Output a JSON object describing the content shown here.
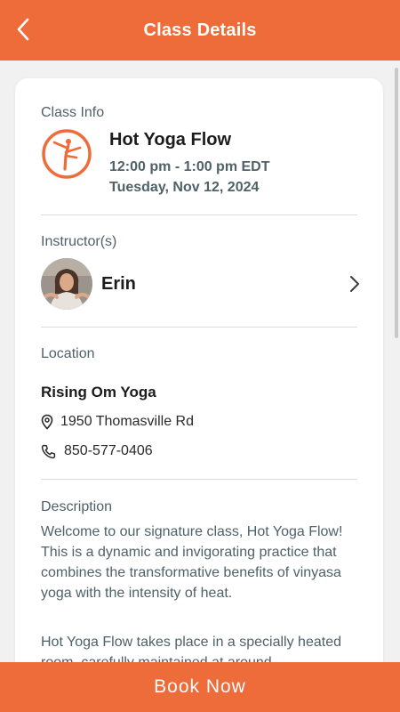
{
  "header": {
    "title": "Class Details",
    "back_icon": "chevron-left-icon",
    "color": "#ee6b3a"
  },
  "class_info": {
    "section_label": "Class Info",
    "icon": "yoga-pose-icon",
    "name": "Hot Yoga Flow",
    "time": "12:00 pm - 1:00 pm EDT",
    "date": "Tuesday, Nov 12, 2024"
  },
  "instructor": {
    "section_label": "Instructor(s)",
    "name": "Erin",
    "chevron_icon": "chevron-right-icon"
  },
  "location": {
    "section_label": "Location",
    "name": "Rising Om Yoga",
    "address": "1950 Thomasville Rd",
    "address_icon": "map-pin-icon",
    "phone": "850-577-0406",
    "phone_icon": "phone-icon"
  },
  "description": {
    "section_label": "Description",
    "paragraph_1": "Welcome to our signature class, Hot Yoga Flow! This is a dynamic and invigorating practice that combines the transformative benefits of vinyasa yoga with the intensity of heat.",
    "paragraph_2": "Hot Yoga Flow takes place in a specially heated room, carefully maintained at around"
  },
  "footer": {
    "book_label": "Book Now"
  },
  "colors": {
    "accent": "#ee6b3a",
    "muted_text": "#4f6169",
    "background": "#f1f1f1"
  }
}
